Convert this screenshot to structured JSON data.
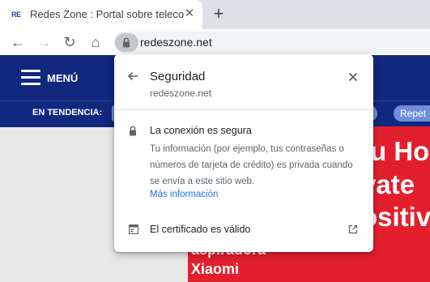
{
  "browser": {
    "tab": {
      "favicon_text": "RE",
      "title": "Redes Zone : Portal sobre telecomunicaciones",
      "close_glyph": "✕"
    },
    "new_tab_glyph": "+",
    "toolbar": {
      "back_glyph": "←",
      "forward_glyph": "→",
      "reload_glyph": "↻",
      "home_glyph": "⌂"
    },
    "url": "redeszone.net"
  },
  "page": {
    "menu_label": "MENÚ",
    "trending_label": "EN TENDENCIA:",
    "trending_pills": [
      "",
      "er",
      "Repet"
    ],
    "hero_lines": [
      "tu Ho",
      "vate",
      "ositiv"
    ],
    "caption_lines": [
      "aspiradora",
      "Xiaomi"
    ]
  },
  "popup": {
    "title": "Seguridad",
    "subtitle": "redeszone.net",
    "secure_title": "La conexión es segura",
    "secure_desc": "Tu información (por ejemplo, tus contraseñas o números de tarjeta de crédito) es privada cuando se envía a este sitio web.",
    "more_info": "Más información",
    "certificate": "El certificado es válido"
  },
  "colors": {
    "site_header": "#10287e",
    "site_hero": "#e41f2d",
    "link": "#1a73e8"
  },
  "icons": [
    "arrow-back-icon",
    "arrow-forward-icon",
    "reload-icon",
    "home-icon",
    "lock-icon",
    "close-icon",
    "certificate-icon",
    "external-link-icon",
    "hamburger-icon"
  ]
}
